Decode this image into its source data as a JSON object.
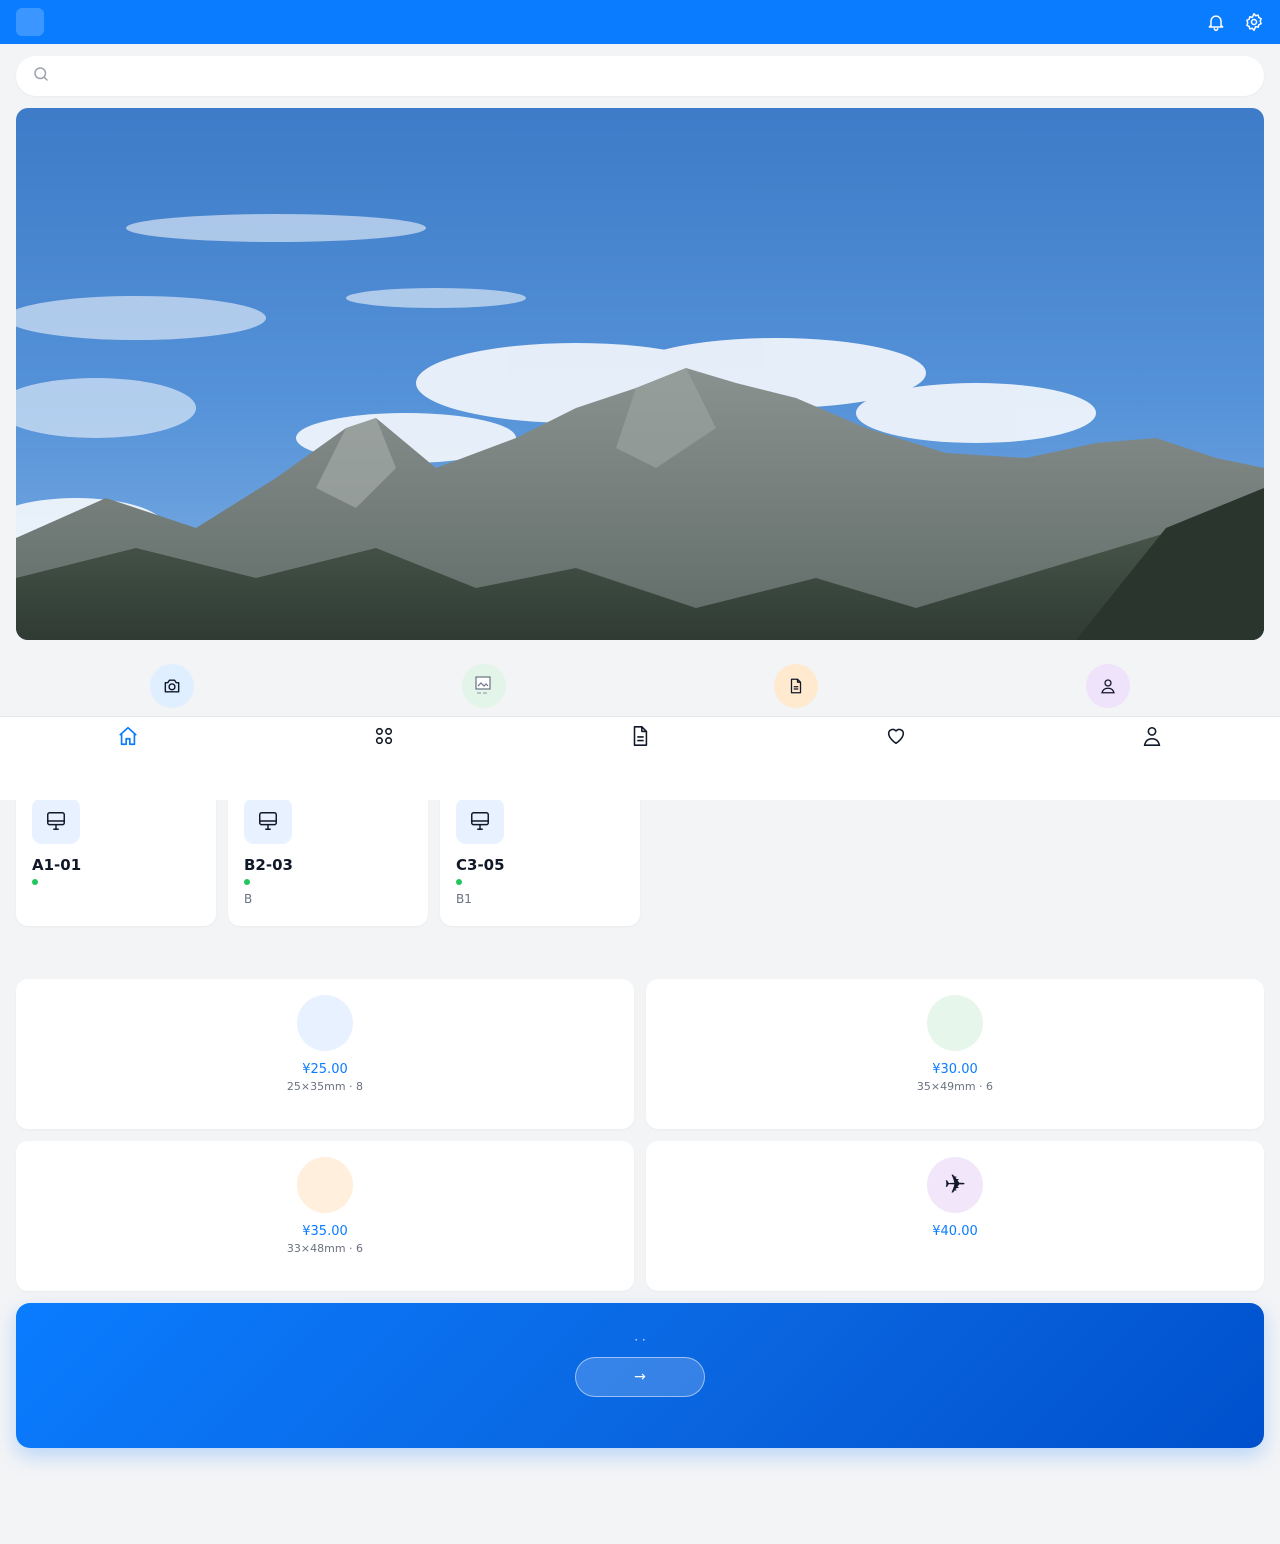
{
  "header": {
    "logo_glyph": "",
    "title": "",
    "icons": [
      "bell-icon",
      "gear-icon"
    ]
  },
  "search": {
    "placeholder": "",
    "value": ""
  },
  "banner": {
    "image": "mountain-landscape"
  },
  "quick_actions": [
    {
      "icon": "camera-icon",
      "color": "#e0efff"
    },
    {
      "icon": "broken-image-icon",
      "color": "#e3f5e8"
    },
    {
      "icon": "document-icon",
      "color": "#ffead0"
    },
    {
      "icon": "user-icon",
      "color": "#efe2fb"
    }
  ],
  "tabbar": {
    "items": [
      {
        "icon": "home-icon",
        "label": "",
        "active": true
      },
      {
        "icon": "grid-icon",
        "label": "",
        "active": false
      },
      {
        "icon": "document-icon",
        "label": "",
        "active": false
      },
      {
        "icon": "heart-icon",
        "label": "",
        "active": false
      },
      {
        "icon": "user-icon",
        "label": "",
        "active": false
      }
    ]
  },
  "studios": [
    {
      "name": "A1-01 ",
      "status": "",
      "location": " "
    },
    {
      "name": "B2-03 ",
      "status": "",
      "location": " B"
    },
    {
      "name": "C3-05 ",
      "status": "",
      "location": " B1"
    }
  ],
  "products_section": {
    "title": " ",
    "more": ""
  },
  "products": [
    {
      "glyph": "",
      "name": "",
      "price": "¥25.00",
      "spec": "25×35mm · 8",
      "color": "#e8f1ff"
    },
    {
      "glyph": "",
      "name": "",
      "price": "¥30.00",
      "spec": "35×49mm · 6",
      "color": "#e6f6ea"
    },
    {
      "glyph": "",
      "name": "",
      "price": "¥35.00",
      "spec": "33×48mm · 6",
      "color": "#ffefdc"
    },
    {
      "glyph": "✈",
      "name": "",
      "price": "¥40.00",
      "spec": "",
      "color": "#f2e6fb"
    }
  ],
  "promo": {
    "title": " ",
    "subtitle": " ·  · ",
    "button": " →"
  },
  "colors": {
    "primary": "#0a7cff",
    "success": "#22c55e"
  }
}
